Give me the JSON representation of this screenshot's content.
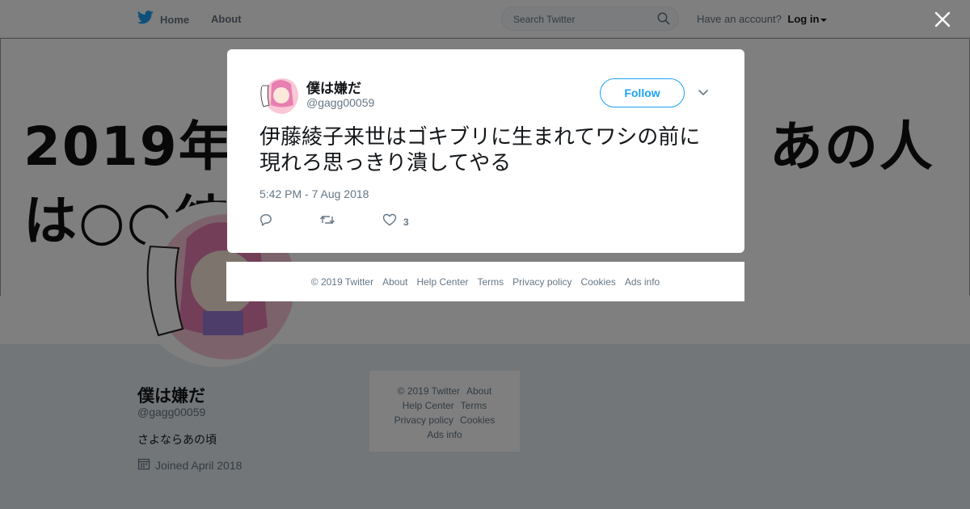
{
  "nav": {
    "home_label": "Home",
    "about_label": "About",
    "search_placeholder": "Search Twitter",
    "account_prompt": "Have an account?",
    "login_label": "Log in"
  },
  "banner": {
    "text": "2019年最も○○するのは？　あの人は○○結婚予想"
  },
  "profile": {
    "name": "僕は嫌だ",
    "handle": "@gagg00059",
    "bio": "さよならあの頃",
    "joined": "Joined April 2018"
  },
  "sidebar_footer": {
    "links": [
      "© 2019 Twitter",
      "About",
      "Help Center",
      "Terms",
      "Privacy policy",
      "Cookies",
      "Ads info"
    ]
  },
  "tweet": {
    "author_name": "僕は嫌だ",
    "author_handle": "@gagg00059",
    "follow_label": "Follow",
    "text": "伊藤綾子来世はゴキブリに生まれてワシの前に現れろ思っきり潰してやる",
    "timestamp": "5:42 PM - 7 Aug 2018",
    "like_count": "3"
  },
  "modal_footer": {
    "links": [
      "© 2019 Twitter",
      "About",
      "Help Center",
      "Terms",
      "Privacy policy",
      "Cookies",
      "Ads info"
    ]
  },
  "colors": {
    "brand": "#1da1f2",
    "text_secondary": "#657786",
    "overlay": "rgba(0,0,0,0.5)"
  },
  "icons": {
    "nav_home": "twitter-bird-icon",
    "search": "search-icon",
    "close": "close-icon",
    "menu": "chevron-down-icon",
    "reply": "reply-icon",
    "retweet": "retweet-icon",
    "like": "heart-icon",
    "joined": "calendar-icon"
  }
}
